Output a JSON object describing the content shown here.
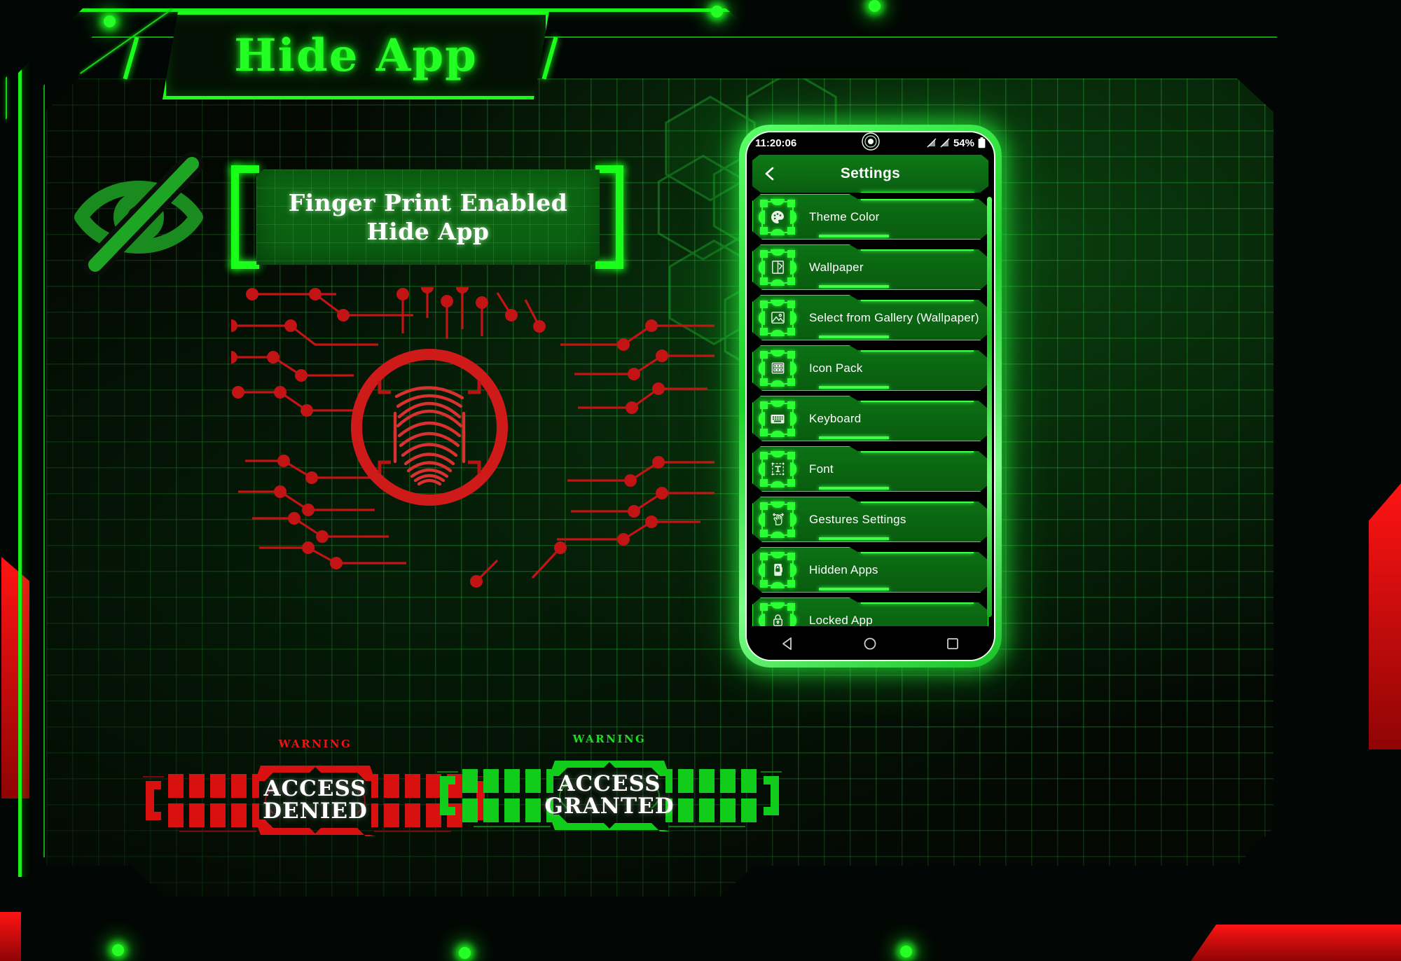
{
  "app": {
    "title": "Hide App",
    "accent_green": "#1aff1a",
    "accent_red": "#ff1414",
    "panel_green": "#0c6b12",
    "bg_dark": "#020604"
  },
  "status_panel": {
    "line1": "Finger Print Enabled",
    "line2": "Hide App",
    "eye_icon": "eye-off-icon"
  },
  "fingerprint": {
    "icon": "fingerprint-scan-icon",
    "color": "#d41f1f"
  },
  "badges": [
    {
      "id": "access-denied",
      "warning": "WARNING",
      "line1": "ACCESS",
      "line2": "DENIED",
      "color": "#e00d0d"
    },
    {
      "id": "access-granted",
      "warning": "WARNING",
      "line1": "ACCESS",
      "line2": "GRANTED",
      "color": "#13d61c"
    }
  ],
  "phone": {
    "statusbar": {
      "time": "11:20:06",
      "signal_icon_1": "signal-slash-icon",
      "signal_icon_2": "signal-slash-icon",
      "battery_percent": "54%",
      "battery_icon": "battery-icon",
      "camera_icon": "front-camera-icon"
    },
    "header": {
      "back_icon": "chevron-left-icon",
      "title": "Settings"
    },
    "settings_items": [
      {
        "label": "Theme Color",
        "icon": "palette-icon"
      },
      {
        "label": "Wallpaper",
        "icon": "wallpaper-icon"
      },
      {
        "label": "Select from Gallery (Wallpaper)",
        "icon": "image-icon"
      },
      {
        "label": "Icon Pack",
        "icon": "icon-grid-icon"
      },
      {
        "label": "Keyboard",
        "icon": "keyboard-icon"
      },
      {
        "label": "Font",
        "icon": "text-format-icon"
      },
      {
        "label": "Gestures Settings",
        "icon": "hand-gesture-icon"
      },
      {
        "label": "Hidden Apps",
        "icon": "phone-lock-icon"
      },
      {
        "label": "Locked App",
        "icon": "padlock-icon"
      }
    ],
    "navbar": {
      "back": "nav-back-icon",
      "home": "nav-home-icon",
      "recents": "nav-recents-icon"
    }
  }
}
